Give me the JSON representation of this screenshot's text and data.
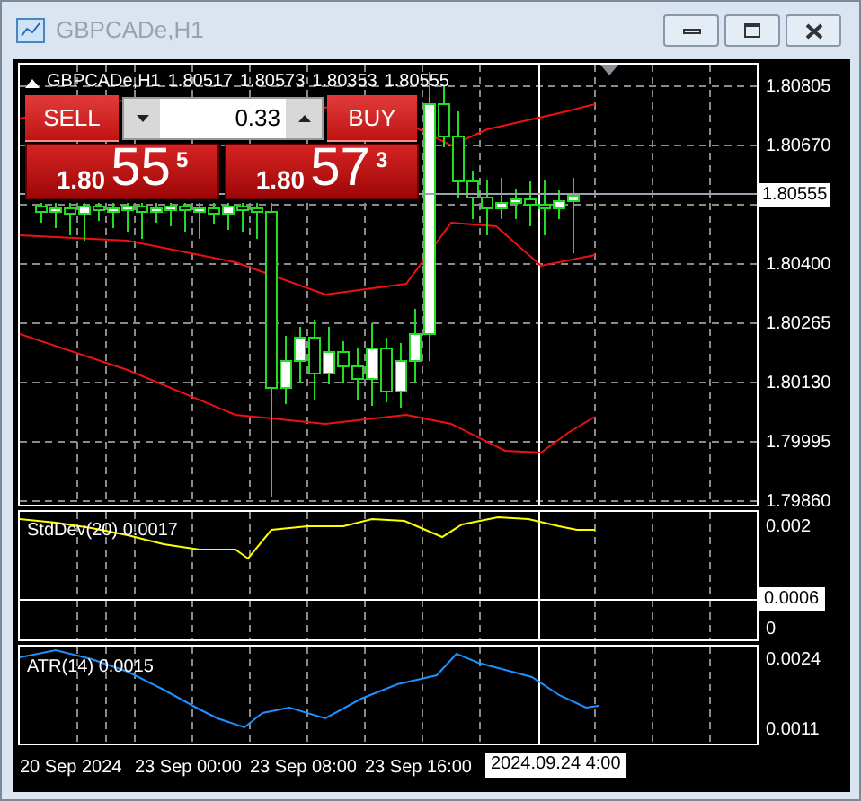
{
  "window": {
    "title": "GBPCADe,H1"
  },
  "chart_header": {
    "symbol": "GBPCADe,H1",
    "ohlc": [
      "1.80517",
      "1.80573",
      "1.80353",
      "1.80555"
    ]
  },
  "trade_panel": {
    "sell_label": "SELL",
    "buy_label": "BUY",
    "volume": "0.33",
    "sell_price": {
      "big": "1.80",
      "pips": "55",
      "fraction": "5"
    },
    "buy_price": {
      "big": "1.80",
      "pips": "57",
      "fraction": "3"
    }
  },
  "price_axis": {
    "ticks": [
      "1.80805",
      "1.80670",
      "1.80400",
      "1.80265",
      "1.80130",
      "1.79995",
      "1.79860"
    ],
    "current": "1.80555"
  },
  "indicators": [
    {
      "label": "StdDev(20) 0.0017",
      "color": "#ffff00",
      "ticks": [
        "0.002",
        "0"
      ],
      "marker": "0.0006"
    },
    {
      "label": "ATR(14) 0.0015",
      "color": "#1e90ff",
      "ticks": [
        "0.0024",
        "0.0011"
      ]
    }
  ],
  "time_axis": {
    "labels": [
      "20 Sep 2024",
      "23 Sep 00:00",
      "23 Sep 08:00",
      "23 Sep 16:00"
    ],
    "cursor": "2024.09.24 4:00"
  }
}
